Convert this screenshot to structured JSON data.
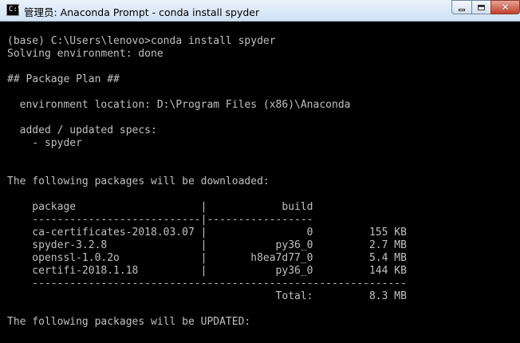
{
  "window": {
    "title": "管理员: Anaconda Prompt - conda  install spyder",
    "app_icon_text": "C:\\"
  },
  "console": {
    "lines": [
      "(base) C:\\Users\\lenovo>conda install spyder",
      "Solving environment: done",
      "",
      "## Package Plan ##",
      "",
      "  environment location: D:\\Program Files (x86)\\Anaconda",
      "",
      "  added / updated specs:",
      "    - spyder",
      "",
      "",
      "The following packages will be downloaded:",
      "",
      "    package                    |            build",
      "    ---------------------------|-----------------",
      "    ca-certificates-2018.03.07 |                0         155 KB",
      "    spyder-3.2.8               |           py36_0         2.7 MB",
      "    openssl-1.0.2o             |       h8ea7d77_0         5.4 MB",
      "    certifi-2018.1.18          |           py36_0         144 KB",
      "    ------------------------------------------------------------",
      "                                           Total:         8.3 MB",
      "",
      "The following packages will be UPDATED:"
    ]
  }
}
